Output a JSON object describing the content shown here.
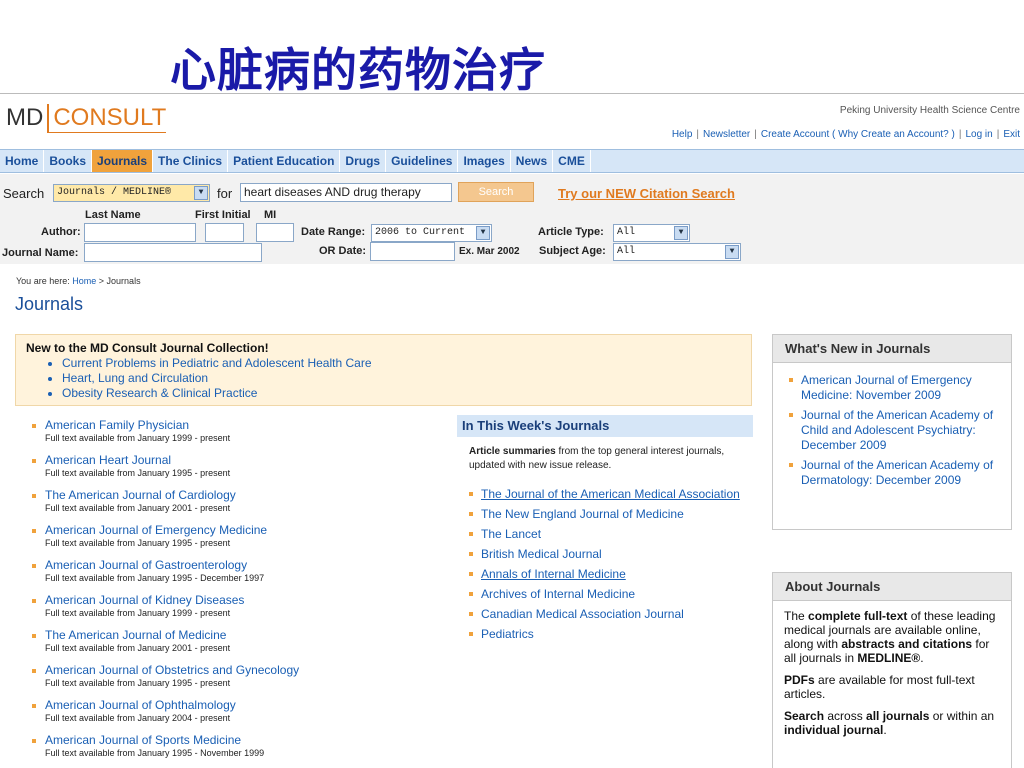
{
  "slide_title": "心脏病的药物治疗",
  "header": {
    "logo_md": "MD",
    "logo_consult": "CONSULT",
    "institution": "Peking University Health Science Centre",
    "top_links": [
      "Help",
      "Newsletter",
      "Create Account",
      "( Why Create an Account? )",
      "Log in",
      "Exit"
    ]
  },
  "nav": {
    "items": [
      "Home",
      "Books",
      "Journals",
      "The Clinics",
      "Patient Education",
      "Drugs",
      "Guidelines",
      "Images",
      "News",
      "CME"
    ],
    "active": "Journals"
  },
  "search": {
    "search_label": "Search",
    "scope_value": "Journals / MEDLINE®",
    "for_label": "for",
    "query_value": "heart diseases AND drug therapy",
    "button_label": "Search",
    "citation_link": "Try our NEW Citation Search",
    "last_name_label": "Last Name",
    "first_initial_label": "First Initial",
    "mi_label": "MI",
    "author_label": "Author:",
    "journal_name_label": "Journal Name:",
    "date_range_label": "Date Range:",
    "date_range_value": "2006 to Current",
    "or_date_label": "OR Date:",
    "date_example": "Ex. Mar 2002",
    "article_type_label": "Article Type:",
    "article_type_value": "All",
    "subject_age_label": "Subject Age:",
    "subject_age_value": "All"
  },
  "breadcrumb": {
    "prefix": "You are here:",
    "home": "Home",
    "sep": ">",
    "current": "Journals"
  },
  "page_heading": "Journals",
  "new_collection": {
    "title": "New to the MD Consult Journal Collection!",
    "items": [
      "Current Problems in Pediatric and Adolescent Health Care",
      "Heart, Lung and Circulation",
      "Obesity Research & Clinical Practice"
    ]
  },
  "journals": [
    {
      "name": "American Family Physician",
      "availability": "Full text available from January 1999 - present"
    },
    {
      "name": "American Heart Journal",
      "availability": "Full text available from January 1995 - present"
    },
    {
      "name": "The American Journal of Cardiology",
      "availability": "Full text available from January 2001 - present"
    },
    {
      "name": "American Journal of Emergency Medicine",
      "availability": "Full text available from January 1995 - present"
    },
    {
      "name": "American Journal of Gastroenterology",
      "availability": "Full text available from January 1995 - December 1997"
    },
    {
      "name": "American Journal of Kidney Diseases",
      "availability": "Full text available from January 1999 - present"
    },
    {
      "name": "The American Journal of Medicine",
      "availability": "Full text available from January 2001 - present"
    },
    {
      "name": "American Journal of Obstetrics and Gynecology",
      "availability": "Full text available from January 1995 - present"
    },
    {
      "name": "American Journal of Ophthalmology",
      "availability": "Full text available from January 2004 - present"
    },
    {
      "name": "American Journal of Sports Medicine",
      "availability": "Full text available from January 1995 - November 1999"
    }
  ],
  "this_week": {
    "title": "In This Week's Journals",
    "desc_bold": "Article summaries",
    "desc_rest": " from the top general interest journals, updated with new issue release.",
    "items": [
      "The Journal of the American Medical Association",
      "The New England Journal of Medicine",
      "The Lancet",
      "British Medical Journal",
      "Annals of Internal Medicine",
      "Archives of Internal Medicine",
      "Canadian Medical Association Journal",
      "Pediatrics"
    ]
  },
  "whats_new": {
    "title": "What's New in Journals",
    "items": [
      "American Journal of Emergency Medicine: November 2009",
      "Journal of the American Academy of Child and Adolescent Psychiatry: December 2009",
      "Journal of the American Academy of Dermatology: December 2009"
    ]
  },
  "about": {
    "title": "About Journals",
    "p1_a": "The ",
    "p1_b": "complete full-text",
    "p1_c": " of these leading medical journals are available online, along with ",
    "p1_d": "abstracts and citations",
    "p1_e": " for all journals in ",
    "p1_f": "MEDLINE®",
    "p1_g": ".",
    "p2_a": "PDFs",
    "p2_b": " are available for most full-text articles.",
    "p3_a": "Search",
    "p3_b": " across ",
    "p3_c": "all journals",
    "p3_d": " or within an ",
    "p3_e": "individual journal",
    "p3_f": "."
  },
  "colors": {
    "accent": "#e07a1f",
    "link": "#1a5fb4",
    "nav_bg": "#d6e6f7",
    "nav_active": "#f0a23c",
    "title": "#1a1aa8"
  }
}
